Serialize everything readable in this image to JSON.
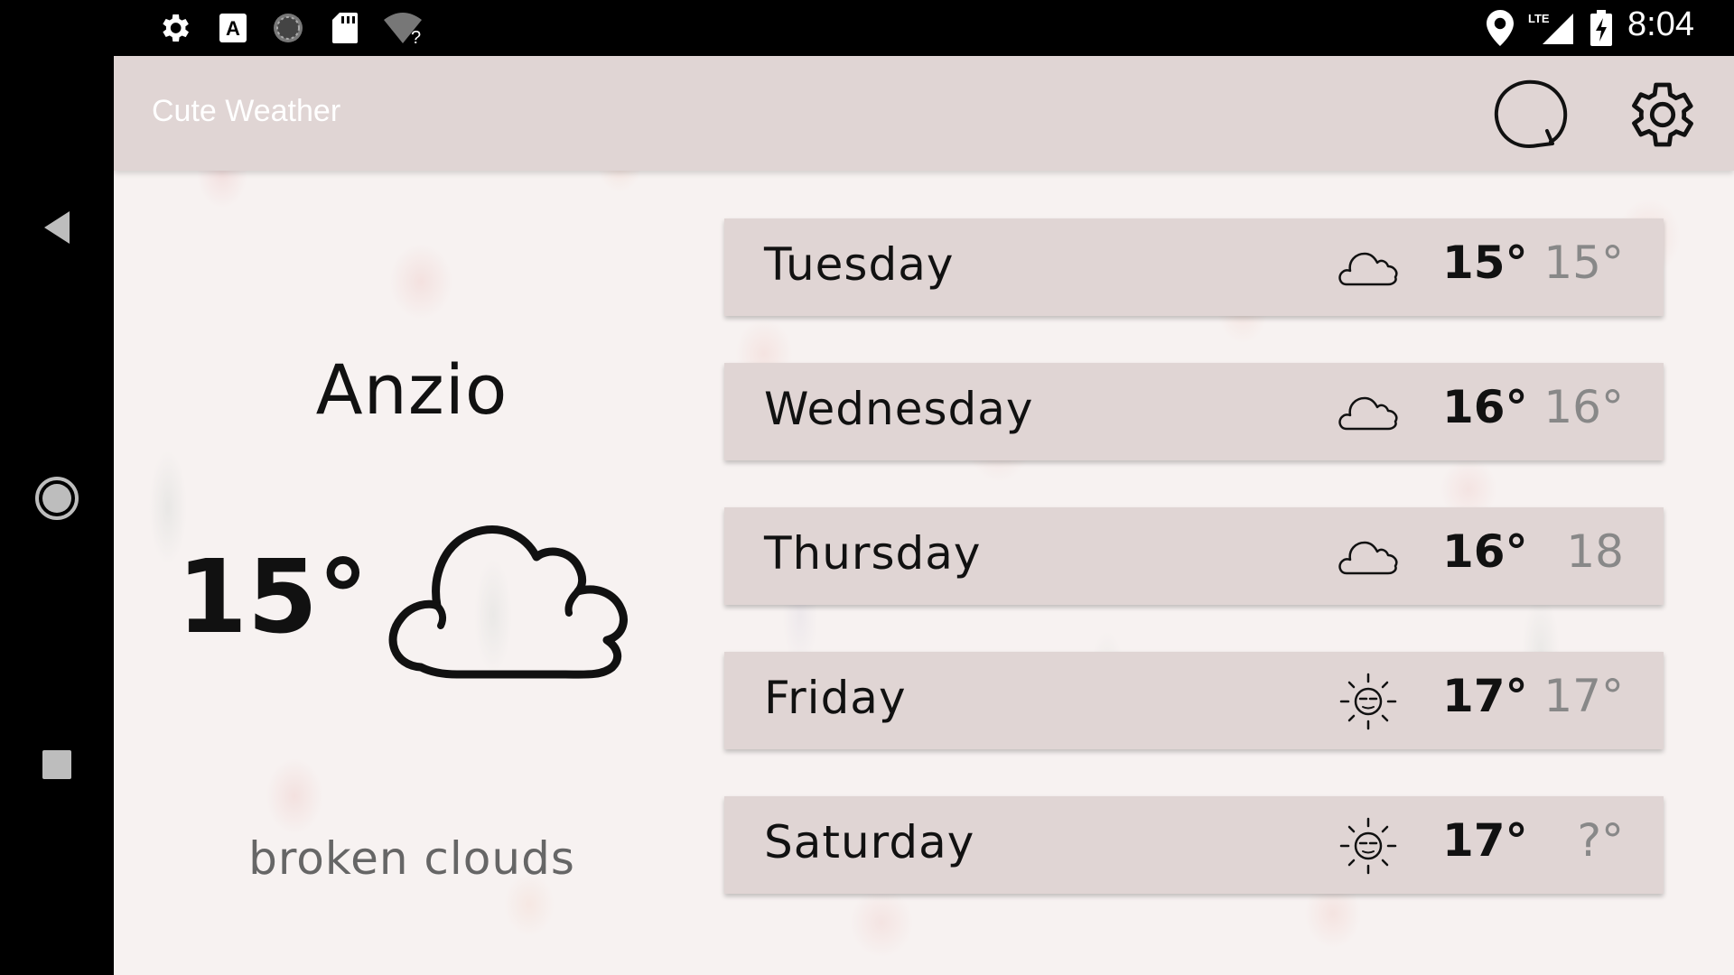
{
  "status_bar": {
    "time": "8:04",
    "network": "LTE",
    "icons": [
      "settings-gear-icon",
      "keyboard-a-icon",
      "sync-circle-icon",
      "sd-card-icon",
      "wifi-unknown-icon",
      "location-pin-icon",
      "cell-signal-icon",
      "battery-charging-icon"
    ]
  },
  "nav_bar": {
    "icons": [
      "back-triangle-icon",
      "home-circle-icon",
      "recents-square-icon"
    ]
  },
  "toolbar": {
    "title": "Cute Weather",
    "actions": [
      "refresh-icon",
      "settings-icon"
    ]
  },
  "current": {
    "city": "Anzio",
    "temp": "15°",
    "condition": "broken clouds",
    "icon": "cloud-icon"
  },
  "forecast": [
    {
      "day": "Tuesday",
      "icon": "cloud-icon",
      "high": "15°",
      "low": "15°"
    },
    {
      "day": "Wednesday",
      "icon": "cloud-icon",
      "high": "16°",
      "low": "16°"
    },
    {
      "day": "Thursday",
      "icon": "cloud-icon",
      "high": "16°",
      "low": "18"
    },
    {
      "day": "Friday",
      "icon": "sun-icon",
      "high": "17°",
      "low": "17°"
    },
    {
      "day": "Saturday",
      "icon": "sun-icon",
      "high": "17°",
      "low": "?°"
    }
  ],
  "colors": {
    "toolbar": "#e0d5d4",
    "card": "#e0d5d4",
    "background": "#f7f2f1",
    "text_dark": "#111111",
    "text_muted": "#888888"
  }
}
